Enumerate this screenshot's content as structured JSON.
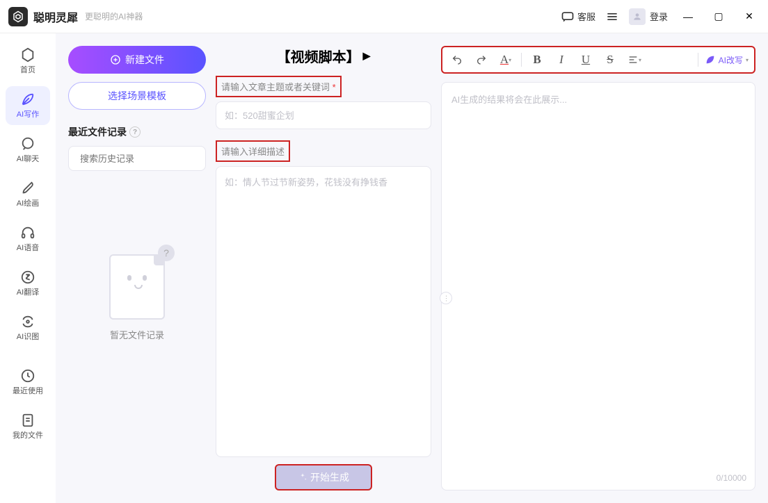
{
  "app": {
    "name": "聪明灵犀",
    "subtitle": "更聪明的AI神器"
  },
  "titlebar": {
    "kefu": "客服",
    "login": "登录"
  },
  "sidebar": {
    "items": [
      {
        "label": "首页"
      },
      {
        "label": "AI写作"
      },
      {
        "label": "AI聊天"
      },
      {
        "label": "AI绘画"
      },
      {
        "label": "AI语音"
      },
      {
        "label": "AI翻译"
      },
      {
        "label": "AI识图"
      },
      {
        "label": "最近使用"
      },
      {
        "label": "我的文件"
      }
    ]
  },
  "left": {
    "new_file": "新建文件",
    "template": "选择场景模板",
    "recent_title": "最近文件记录",
    "search_placeholder": "搜索历史记录",
    "empty": "暂无文件记录"
  },
  "mid": {
    "title": "【视频脚本】",
    "label_topic": "请输入文章主题或者关键词",
    "required_mark": "*",
    "topic_placeholder": "如：520甜蜜企划",
    "label_detail": "请输入详细描述",
    "detail_placeholder": "如：情人节过节新姿势，花钱没有挣钱香",
    "generate": "开始生成"
  },
  "right": {
    "ai_rewrite": "AI改写",
    "preview_placeholder": "AI生成的结果将会在此展示...",
    "char_count": "0/10000"
  }
}
